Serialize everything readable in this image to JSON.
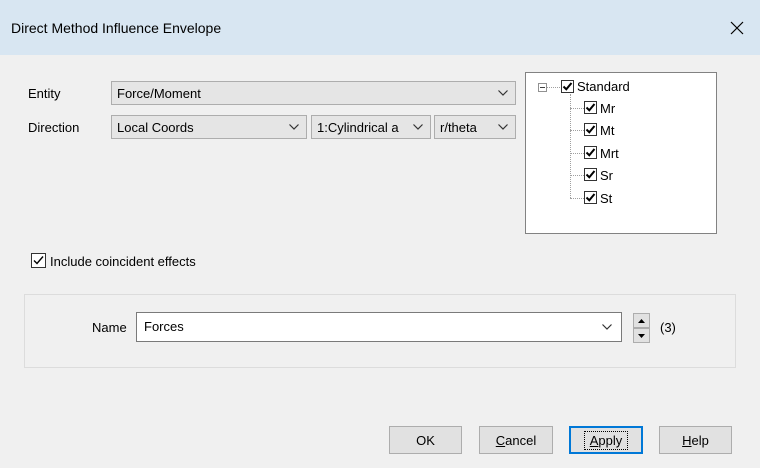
{
  "window": {
    "title": "Direct Method Influence Envelope",
    "close_glyph": "✕"
  },
  "form": {
    "entity_label": "Entity",
    "entity_value": "Force/Moment",
    "direction_label": "Direction",
    "direction_value": "Local Coords",
    "coord_system_value": "1:Cylindrical a",
    "component_value": "r/theta"
  },
  "tree": {
    "root": {
      "label": "Standard",
      "checked": true,
      "expanded": true
    },
    "children": [
      {
        "label": "Mr",
        "checked": true
      },
      {
        "label": "Mt",
        "checked": true
      },
      {
        "label": "Mrt",
        "checked": true
      },
      {
        "label": "Sr",
        "checked": true
      },
      {
        "label": "St",
        "checked": true
      }
    ]
  },
  "include_coincident": {
    "label": "Include coincident effects",
    "checked": true
  },
  "name": {
    "label": "Name",
    "value": "Forces",
    "count": "(3)"
  },
  "buttons": {
    "ok": "OK",
    "cancel_first": "C",
    "cancel_rest": "ancel",
    "apply_first": "A",
    "apply_rest": "pply",
    "help_first": "H",
    "help_rest": "elp"
  },
  "colors": {
    "titlebar": "#d8e6f2",
    "dialog_bg": "#f0f0f0",
    "focus_border": "#0078d7"
  }
}
